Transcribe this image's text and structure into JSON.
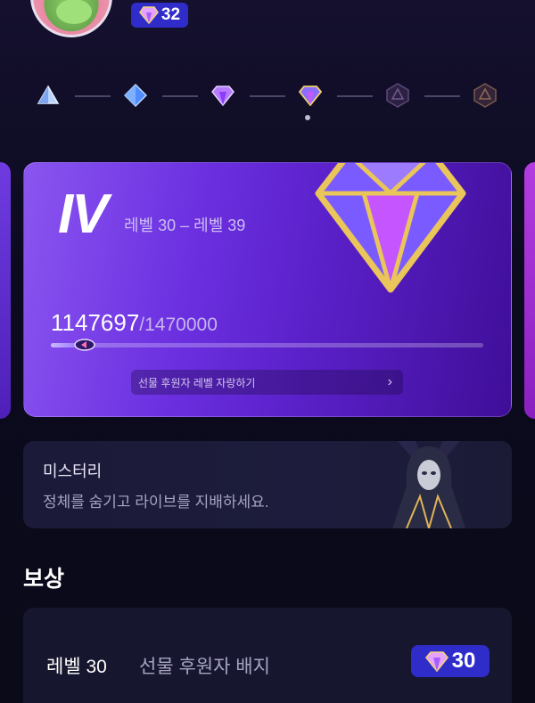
{
  "profile": {
    "gem_count": "32"
  },
  "level_track": {
    "nodes": [
      {
        "icon": "triangle-crystal-icon"
      },
      {
        "icon": "blue-diamond-icon"
      },
      {
        "icon": "purple-diamond-icon"
      },
      {
        "icon": "violet-diamond-icon",
        "current": true
      },
      {
        "icon": "locked-crystal-icon"
      },
      {
        "icon": "locked-orange-crystal-icon"
      }
    ]
  },
  "level_card": {
    "tier": "IV",
    "range": "레벨 30 – 레벨 39",
    "progress_current": "1147697",
    "progress_total": "/1470000",
    "progress_fraction": 0.078,
    "brag_label": "선물 후원자 레벨 자랑하기",
    "brag_chevron": "›"
  },
  "mystery": {
    "title": "미스터리",
    "description": "정체를 숨기고 라이브를 지배하세요."
  },
  "rewards": {
    "section_title": "보상",
    "items": [
      {
        "level": "레벨 30",
        "name": "선물 후원자 배지",
        "cost": "30"
      }
    ]
  },
  "colors": {
    "accent_blue": "#2f2cc9",
    "card_purple": "#6b2fe0",
    "gold": "#e9c55a"
  }
}
